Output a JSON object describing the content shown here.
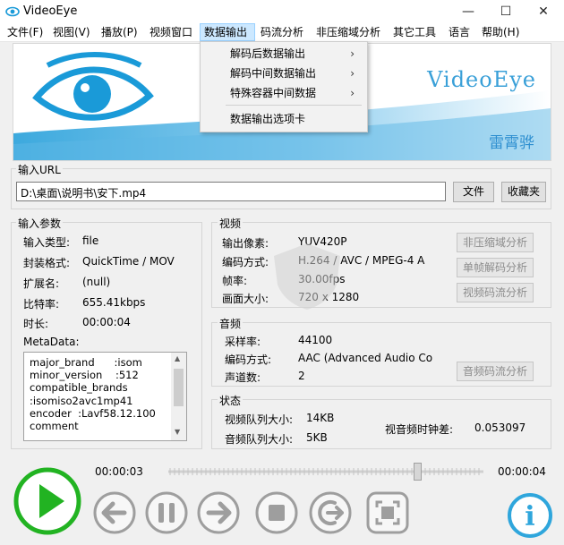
{
  "window": {
    "title": "VideoEye",
    "minimize": "—",
    "maximize": "☐",
    "close": "✕"
  },
  "menu": [
    "文件(F)",
    "视图(V)",
    "播放(P)",
    "视频窗口",
    "数据输出",
    "码流分析",
    "非压缩域分析",
    "其它工具",
    "语言",
    "帮助(H)"
  ],
  "dropdown": {
    "items": [
      "解码后数据输出",
      "解码中间数据输出",
      "特殊容器中间数据",
      "数据输出选项卡"
    ],
    "submenu_arrow": "›"
  },
  "banner": {
    "brand": "VideoEye",
    "author": "雷霄骅"
  },
  "url": {
    "title": "输入URL",
    "value": "D:\\桌面\\说明书\\安下.mp4",
    "file_btn": "文件",
    "fav_btn": "收藏夹"
  },
  "input_params": {
    "title": "输入参数",
    "rows": [
      {
        "label": "输入类型:",
        "value": "file"
      },
      {
        "label": "封装格式:",
        "value": "QuickTime / MOV"
      },
      {
        "label": "扩展名:",
        "value": "(null)"
      },
      {
        "label": "比特率:",
        "value": "655.41kbps"
      },
      {
        "label": "时长:",
        "value": "00:00:04"
      }
    ],
    "metadata_label": "MetaData:",
    "metadata": "major_brand      :isom\nminor_version    :512\ncompatible_brands\n:isomiso2avc1mp41\nencoder  :Lavf58.12.100\ncomment"
  },
  "video": {
    "title": "视频",
    "rows": [
      {
        "label": "输出像素:",
        "value": "YUV420P"
      },
      {
        "label": "编码方式:",
        "value": "H.264 / AVC / MPEG-4 A"
      },
      {
        "label": "帧率:",
        "value": "30.00fps"
      },
      {
        "label": "画面大小:",
        "value": "720 x 1280"
      }
    ],
    "buttons": [
      "非压缩域分析",
      "单帧解码分析",
      "视频码流分析"
    ]
  },
  "audio": {
    "title": "音频",
    "rows": [
      {
        "label": "采样率:",
        "value": "44100"
      },
      {
        "label": "编码方式:",
        "value": "AAC (Advanced Audio Co"
      },
      {
        "label": "声道数:",
        "value": "2"
      }
    ],
    "button": "音频码流分析"
  },
  "status": {
    "title": "状态",
    "video_queue_label": "视频队列大小:",
    "video_queue": "14KB",
    "audio_queue_label": "音频队列大小:",
    "audio_queue": "5KB",
    "av_diff_label": "视音频时钟差:",
    "av_diff": "0.053097"
  },
  "player": {
    "current_time": "00:00:03",
    "total_time": "00:00:04",
    "progress": 0.8,
    "info": "i"
  },
  "colors": {
    "accent": "#2fa6dc",
    "play": "#22b322",
    "banner_eye": "#1a9ad8"
  },
  "icons": [
    "play-icon",
    "prev-icon",
    "pause-icon",
    "next-icon",
    "stop-icon",
    "step-icon",
    "fullscreen-icon",
    "info-icon"
  ]
}
